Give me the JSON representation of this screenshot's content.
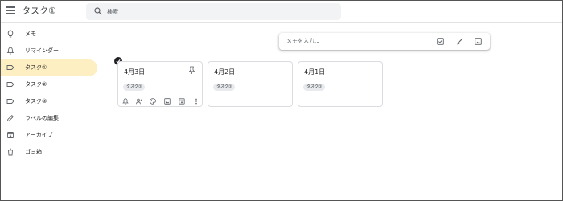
{
  "app": {
    "title": "タスク①"
  },
  "search": {
    "placeholder": "検索"
  },
  "sidebar": {
    "items": [
      {
        "label": "メモ",
        "icon": "lightbulb-icon"
      },
      {
        "label": "リマインダー",
        "icon": "bell-icon"
      },
      {
        "label": "タスク①",
        "icon": "label-icon",
        "active": true
      },
      {
        "label": "タスク②",
        "icon": "label-icon"
      },
      {
        "label": "タスク③",
        "icon": "label-icon"
      },
      {
        "label": "ラベルの編集",
        "icon": "pencil-icon"
      },
      {
        "label": "アーカイブ",
        "icon": "archive-icon"
      },
      {
        "label": "ゴミ箱",
        "icon": "trash-icon"
      }
    ]
  },
  "note_input": {
    "placeholder": "メモを入力...",
    "icons": [
      "checkbox-icon",
      "brush-icon",
      "image-icon"
    ]
  },
  "notes": [
    {
      "title": "4月3日",
      "label": "タスク①",
      "selected": true
    },
    {
      "title": "4月2日",
      "label": "タスク①"
    },
    {
      "title": "4月1日",
      "label": "タスク①"
    }
  ],
  "card_toolbar": {
    "icons": [
      "reminder-icon",
      "collaborator-icon",
      "palette-icon",
      "image-icon",
      "archive-icon",
      "more-icon"
    ]
  },
  "colors": {
    "active_nav": "#feefc3",
    "search_bg": "#f1f3f4",
    "card_border": "#dadce0",
    "chip_bg": "#e8eaed"
  }
}
